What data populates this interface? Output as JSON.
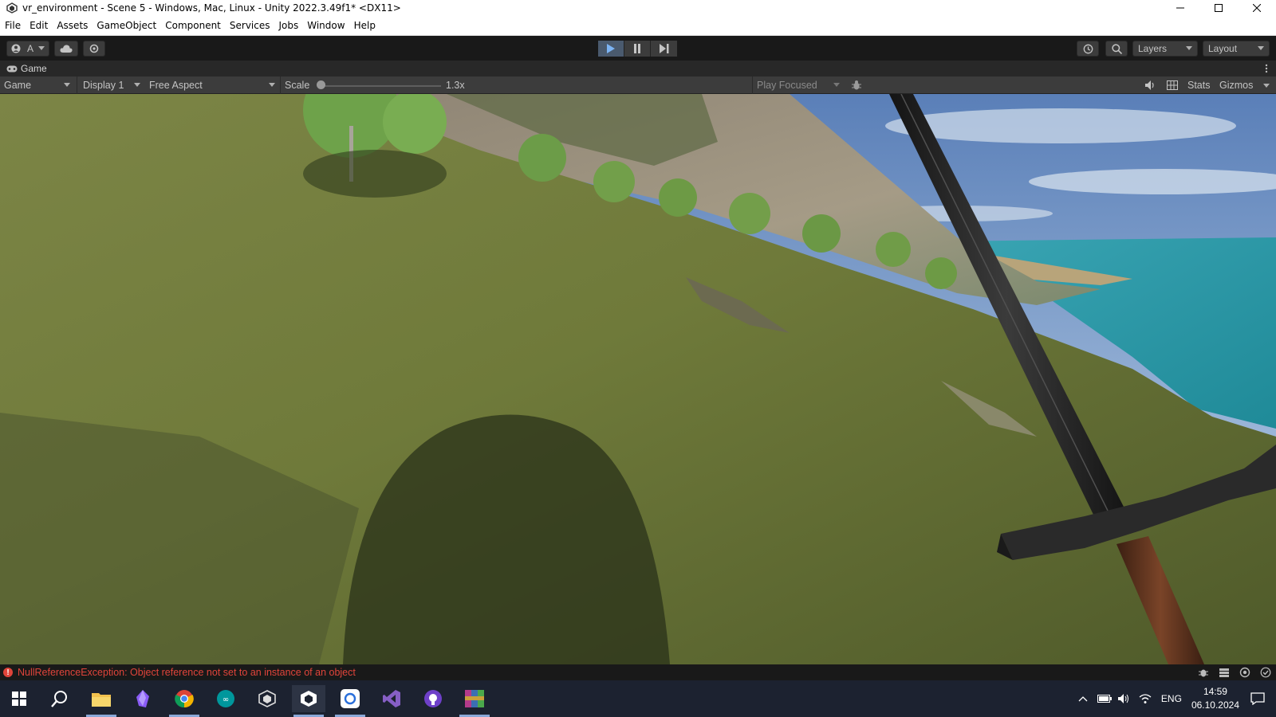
{
  "window": {
    "title": "vr_environment - Scene 5 - Windows, Mac, Linux - Unity 2022.3.49f1* <DX11>"
  },
  "menu": [
    "File",
    "Edit",
    "Assets",
    "GameObject",
    "Component",
    "Services",
    "Jobs",
    "Window",
    "Help"
  ],
  "toolbar": {
    "account_label": "A",
    "layers_label": "Layers",
    "layout_label": "Layout"
  },
  "game_tab": {
    "label": "Game"
  },
  "game_bar": {
    "view_mode": "Game",
    "display": "Display 1",
    "aspect": "Free Aspect",
    "scale_label": "Scale",
    "scale_value": "1.3x",
    "scale_level": 0.0,
    "play_mode": "Play Focused",
    "stats_label": "Stats",
    "gizmos_label": "Gizmos"
  },
  "status": {
    "error_icon": "!",
    "error_message": "NullReferenceException: Object reference not set to an instance of an object"
  },
  "taskbar": {
    "icons": [
      "windows-start-icon",
      "search-icon",
      "file-explorer-icon",
      "obsidian-icon",
      "chrome-icon",
      "arduino-icon",
      "unity-hub-icon",
      "unity-editor-icon",
      "app-icon",
      "visual-studio-icon",
      "github-desktop-icon",
      "winrar-icon"
    ],
    "language": "ENG",
    "time": "14:59",
    "date": "06.10.2024"
  },
  "colors": {
    "error": "#e0443a",
    "accent_play": "#4a5a6e",
    "editor_dark": "#191919"
  }
}
